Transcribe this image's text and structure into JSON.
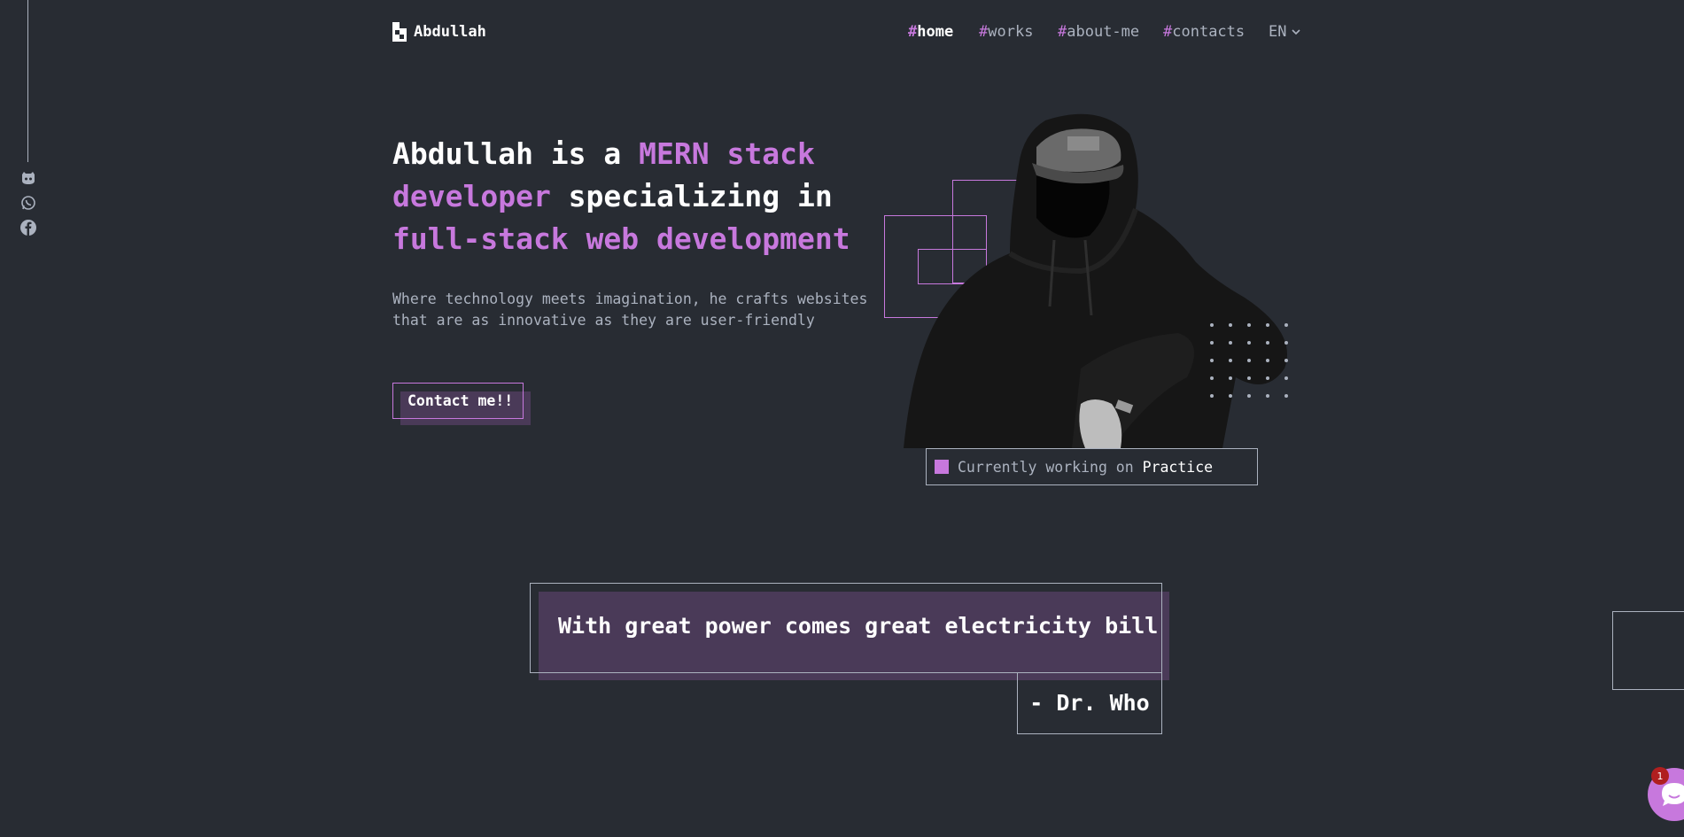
{
  "header": {
    "logo_text": "Abdullah",
    "nav": [
      {
        "hash": "#",
        "label": "home"
      },
      {
        "hash": "#",
        "label": "works"
      },
      {
        "hash": "#",
        "label": "about-me"
      },
      {
        "hash": "#",
        "label": "contacts"
      }
    ],
    "language": "EN"
  },
  "social": [
    "github-icon",
    "whatsapp-icon",
    "facebook-icon"
  ],
  "hero": {
    "headline": {
      "p1": "Abdullah is a ",
      "p2": "MERN stack developer",
      "p3": " specializing in ",
      "p4": "full-stack web development"
    },
    "subtitle": "Where technology meets imagination, he crafts websites that are as innovative as they are user-friendly",
    "cta_label": "Contact me!!",
    "status_prefix": "Currently working on ",
    "status_project": "Practice"
  },
  "quote": {
    "text": "With great power comes great electricity bill",
    "author": "- Dr. Who"
  },
  "chat": {
    "badge_count": "1"
  },
  "colors": {
    "background": "#282c33",
    "accent": "#c778dd",
    "muted": "#abb2bf"
  }
}
